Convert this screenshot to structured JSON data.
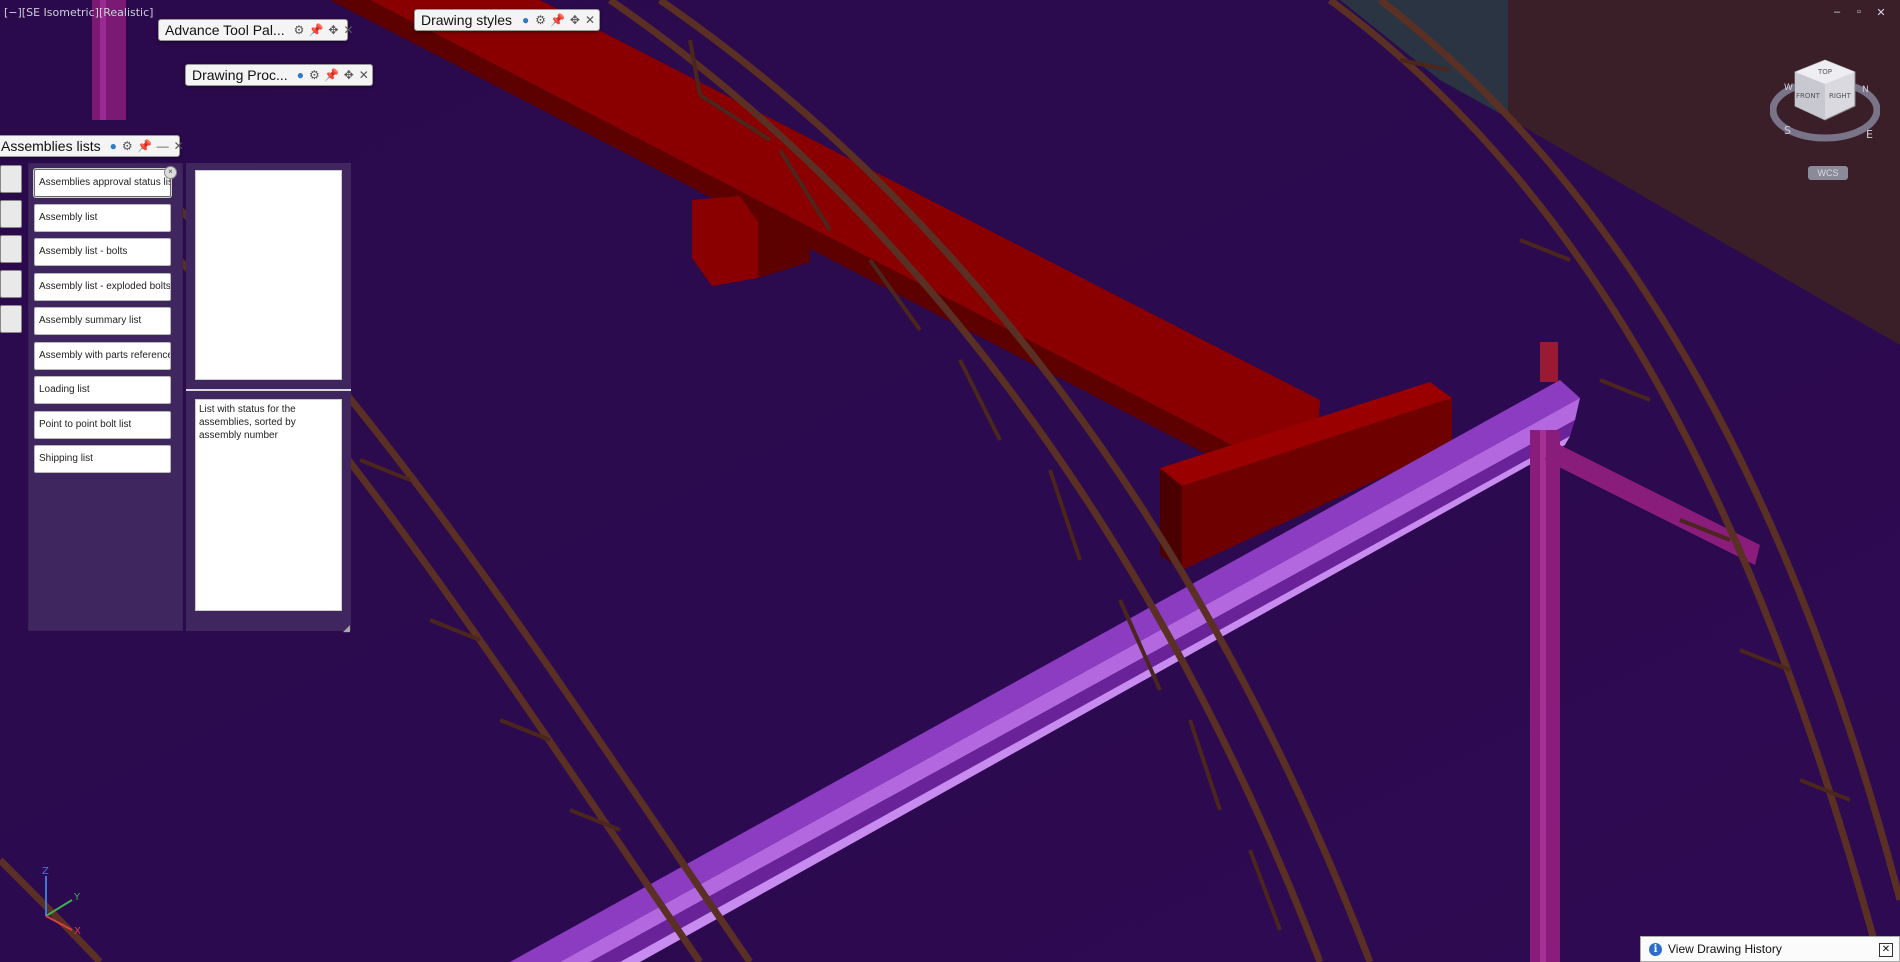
{
  "viewport": {
    "label": "[−][SE Isometric][Realistic]"
  },
  "window_controls": [
    "–",
    "▫",
    "✕"
  ],
  "palettes": {
    "advance_tool": {
      "title": "Advance Tool Pal..."
    },
    "drawing_styles": {
      "title": "Drawing styles"
    },
    "drawing_proc": {
      "title": "Drawing Proc..."
    },
    "assemblies": {
      "title": "Assemblies lists",
      "items": [
        "Assemblies approval status list",
        "Assembly list",
        "Assembly list - bolts",
        "Assembly list - exploded bolts",
        "Assembly summary list",
        "Assembly with parts reference",
        "Loading list",
        "Point to point bolt list",
        "Shipping list"
      ],
      "description": "List with status for the assemblies, sorted by assembly number"
    }
  },
  "viewcube": {
    "top": "TOP",
    "front": "FRONT",
    "right": "RIGHT",
    "compass": {
      "n": "N",
      "s": "S",
      "e": "E",
      "w": "W"
    },
    "wcs": "WCS"
  },
  "ucs": {
    "x": "X",
    "y": "Y",
    "z": "Z"
  },
  "history": {
    "label": "View Drawing History",
    "info": "i",
    "close": "✕"
  },
  "icons": {
    "tb": [
      "globe-icon",
      "gear-icon",
      "pin-icon",
      "move-icon",
      "close-icon"
    ]
  }
}
